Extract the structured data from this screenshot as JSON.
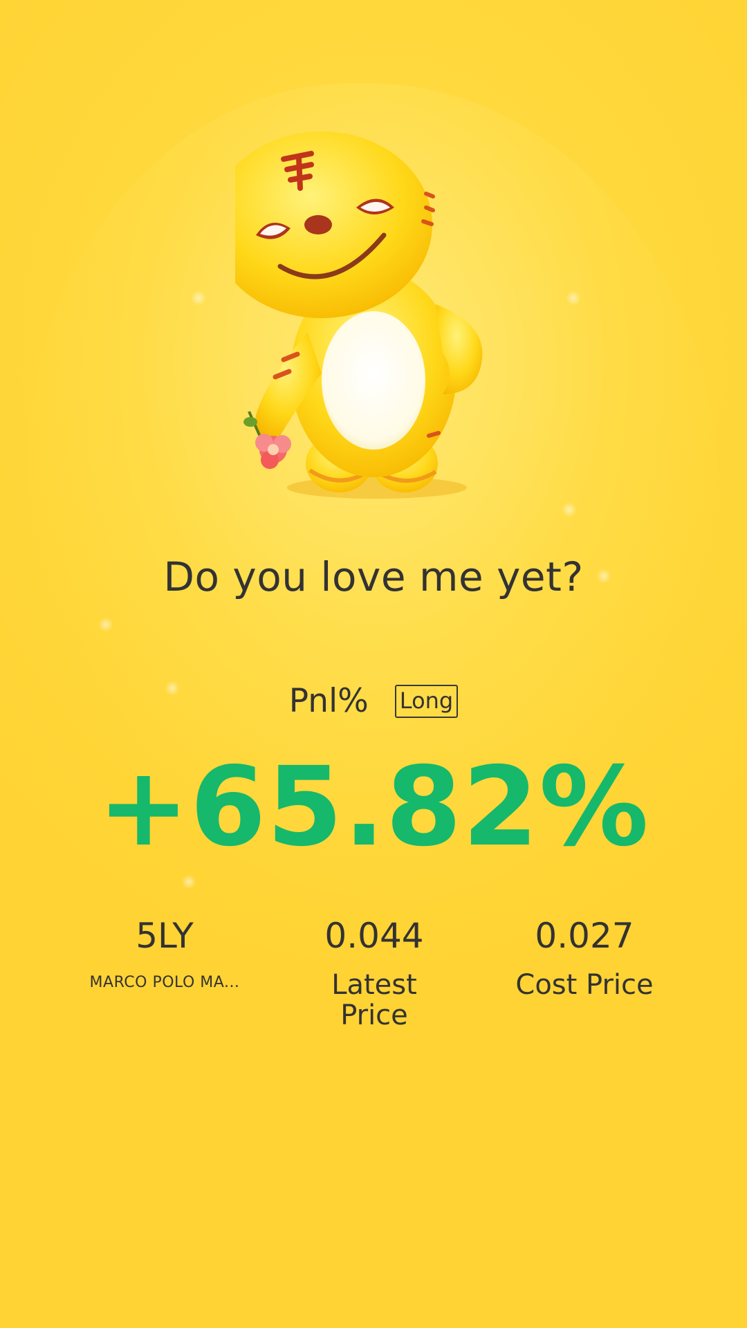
{
  "headline": "Do you love me yet?",
  "pnl": {
    "label": "Pnl%",
    "direction": "Long",
    "value": "+65.82%",
    "value_color": "#16b86b"
  },
  "stats": [
    {
      "value": "5LY",
      "label": "MARCO POLO MA..."
    },
    {
      "value": "0.044",
      "label": "Latest Price"
    },
    {
      "value": "0.027",
      "label": "Cost Price"
    }
  ],
  "mascot": {
    "icon": "tiger-mascot-icon",
    "accessory": "flower-icon"
  },
  "colors": {
    "background": "#ffd640",
    "text": "#333233",
    "accent_green": "#16b86b"
  }
}
